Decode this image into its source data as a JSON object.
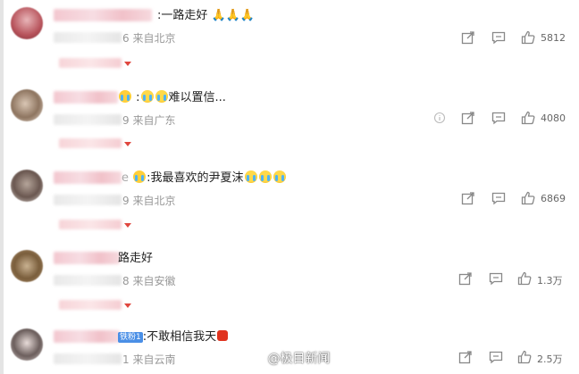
{
  "comments": [
    {
      "text": ":一路走好",
      "emojis": [
        "pray-emoji",
        "pray-emoji",
        "pray-emoji"
      ],
      "time_suffix": "6",
      "location": "来自北京",
      "likes": "5812"
    },
    {
      "text": ":",
      "text_after": "难以置信...",
      "emojis": [
        "cry-emoji",
        "cry-emoji"
      ],
      "time_suffix": "9",
      "location": "来自广东",
      "likes": "4080"
    },
    {
      "text": ":我最喜欢的尹夏沫",
      "emojis": [
        "cry-emoji",
        "cry-emoji",
        "cry-emoji"
      ],
      "name_tail": "e",
      "time_suffix": "9",
      "location": "来自北京",
      "likes": "6869"
    },
    {
      "text": "路走好",
      "time_suffix": "8",
      "location": "来自安徽",
      "likes": "1.3万"
    },
    {
      "text": ":不敢相信我天",
      "badge": "铁粉1",
      "time_suffix": "1",
      "location": "来自云南",
      "likes": "2.5万"
    }
  ],
  "watermark": "@极目新闻",
  "colors": {
    "accent": "#e0463e",
    "meta": "#999999",
    "text": "#222222",
    "icon": "#888888"
  }
}
